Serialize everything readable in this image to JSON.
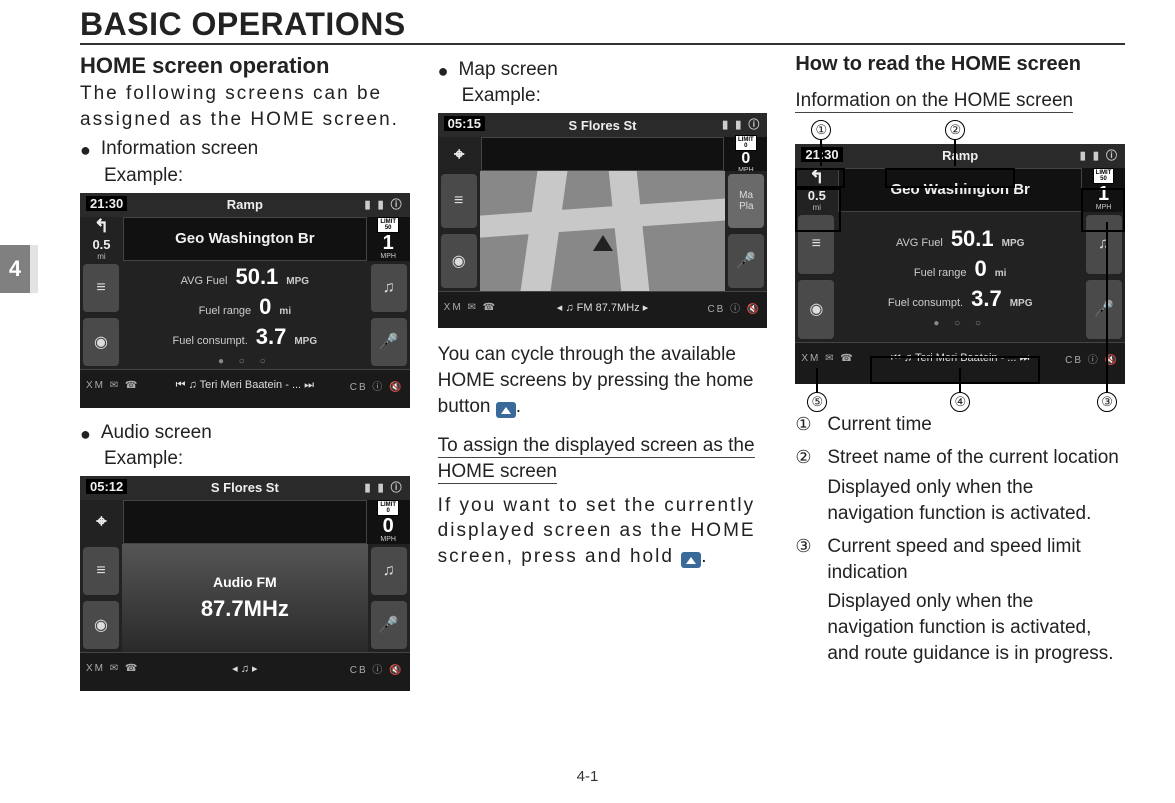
{
  "chapter_tab": "4",
  "page_title": "BASIC OPERATIONS",
  "page_number": "4-1",
  "col1": {
    "heading": "HOME screen operation",
    "intro": "The following screens can be assigned as the HOME screen.",
    "bullet_info": "Information screen",
    "example_label": "Example:",
    "bullet_audio": "Audio screen",
    "info_screen": {
      "time": "21:30",
      "top_label": "Ramp",
      "turn_dist": "0.5",
      "turn_unit": "mi",
      "street": "Geo Washington Br",
      "limit": "50",
      "limit_unit": "MPH",
      "cur_speed": "1",
      "line1_label": "AVG Fuel",
      "line1_val": "50.1",
      "line1_unit": "MPG",
      "line2_label": "Fuel range",
      "line2_val": "0",
      "line2_unit": "mi",
      "line3_label": "Fuel consumpt.",
      "line3_val": "3.7",
      "line3_unit": "MPG",
      "bottom_track": "♫ Teri Meri Baatein - ..."
    },
    "audio_screen": {
      "time": "05:12",
      "top_label": "S Flores St",
      "limit": "0",
      "limit_unit": "MPH",
      "cur_speed": "0",
      "audio_title": "Audio FM",
      "audio_freq": "87.7MHz",
      "bottom_center": "◂   ♫   ▸"
    }
  },
  "col2": {
    "bullet_map": "Map screen",
    "example_label": "Example:",
    "map_screen": {
      "time": "05:15",
      "top_label": "S Flores St",
      "limit": "0",
      "limit_unit": "MPH",
      "cur_speed": "0",
      "bottom_center": "◂  ♫ FM 87.7MHz  ▸"
    },
    "cycle_text_a": "You can cycle through the available HOME screens by pressing the home button ",
    "cycle_text_b": ".",
    "assign_heading": "To assign the displayed screen as the HOME screen",
    "assign_text_a": "If you want to set the currently displayed screen as the HOME screen, press and hold ",
    "assign_text_b": "."
  },
  "col3": {
    "heading": "How to read the HOME screen",
    "sub_heading": "Information on the HOME screen",
    "callouts": {
      "c1": "①",
      "c2": "②",
      "c3": "③",
      "c4": "④",
      "c5": "⑤"
    },
    "figure": {
      "time": "21:30",
      "top_label": "Ramp",
      "turn_dist": "0.5",
      "turn_unit": "mi",
      "street": "Geo Washington Br",
      "limit": "50",
      "limit_unit": "MPH",
      "cur_speed": "1",
      "line1_label": "AVG Fuel",
      "line1_val": "50.1",
      "line1_unit": "MPG",
      "line2_label": "Fuel range",
      "line2_val": "0",
      "line2_unit": "mi",
      "line3_label": "Fuel consumpt.",
      "line3_val": "3.7",
      "line3_unit": "MPG",
      "bottom_track": "♫ Teri Meri Baatein - ..."
    },
    "list": {
      "i1": {
        "num": "①",
        "text": "Current time"
      },
      "i2": {
        "num": "②",
        "text": "Street name of the current location",
        "sub": "Displayed only when the navigation function is activated."
      },
      "i3": {
        "num": "③",
        "text": "Current speed and speed limit indication",
        "sub": "Displayed only when the navigation function is activated, and route guidance is in progress."
      }
    }
  }
}
